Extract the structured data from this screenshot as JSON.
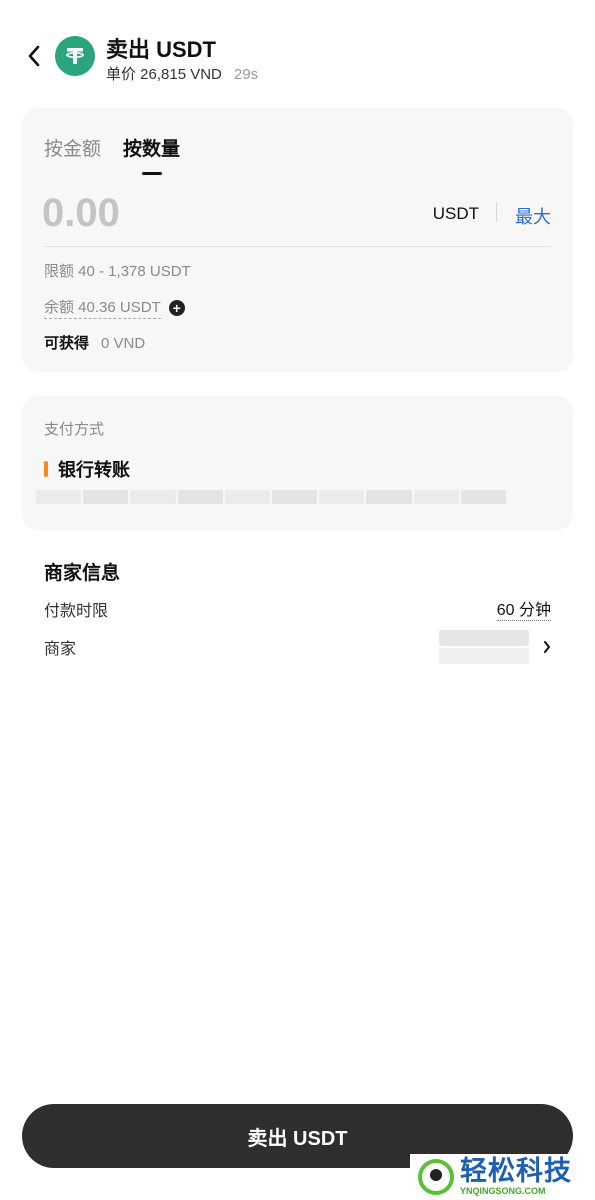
{
  "header": {
    "title": "卖出 USDT",
    "price_line": "单价 26,815 VND",
    "timer": "29s"
  },
  "amount_card": {
    "tabs": [
      {
        "label": "按金额"
      },
      {
        "label": "按数量",
        "active": true
      }
    ],
    "amount_placeholder": "0.00",
    "unit": "USDT",
    "max_label": "最大",
    "limit_text": "限额 40 - 1,378 USDT",
    "balance_text": "余额 40.36 USDT",
    "receive_label": "可获得",
    "receive_value": "0 VND"
  },
  "payment": {
    "label": "支付方式",
    "method": "银行转账"
  },
  "merchant": {
    "title": "商家信息",
    "time_label": "付款时限",
    "time_value": "60 分钟",
    "merchant_label": "商家"
  },
  "footer": {
    "sell_button": "卖出 USDT"
  },
  "watermark": {
    "main": "轻松科技",
    "sub": "YNQINGSONG.COM"
  },
  "colors": {
    "accent_blue": "#2b6fd6",
    "coin_green": "#2aa57e",
    "orange": "#f08a24",
    "button_dark": "#2e2e2e"
  },
  "icons": [
    "back-arrow-icon",
    "tether-icon",
    "add-icon",
    "chevron-right-icon"
  ]
}
